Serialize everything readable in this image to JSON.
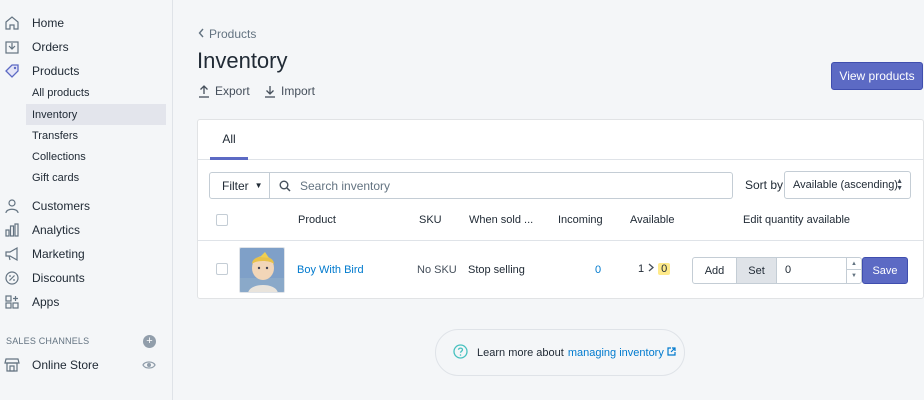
{
  "sidebar": {
    "nav": [
      {
        "label": "Home",
        "icon": "home-icon"
      },
      {
        "label": "Orders",
        "icon": "orders-icon"
      },
      {
        "label": "Products",
        "icon": "tag-icon"
      }
    ],
    "product_sub": [
      {
        "label": "All products"
      },
      {
        "label": "Inventory",
        "active": true
      },
      {
        "label": "Transfers"
      },
      {
        "label": "Collections"
      },
      {
        "label": "Gift cards"
      }
    ],
    "nav2": [
      {
        "label": "Customers",
        "icon": "person-icon"
      },
      {
        "label": "Analytics",
        "icon": "bar-chart-icon"
      },
      {
        "label": "Marketing",
        "icon": "megaphone-icon"
      },
      {
        "label": "Discounts",
        "icon": "discount-icon"
      },
      {
        "label": "Apps",
        "icon": "apps-icon"
      }
    ],
    "sales_channels_title": "SALES CHANNELS",
    "online_store": "Online Store"
  },
  "header": {
    "breadcrumb": "Products",
    "title": "Inventory",
    "export_label": "Export",
    "import_label": "Import",
    "view_products_label": "View products"
  },
  "card": {
    "tab_all": "All",
    "filter_label": "Filter",
    "search_placeholder": "Search inventory",
    "sort_label": "Sort by",
    "sort_value": "Available (ascending)",
    "columns": {
      "product": "Product",
      "sku": "SKU",
      "when_sold": "When sold ...",
      "incoming": "Incoming",
      "available": "Available",
      "edit_qty": "Edit quantity available"
    },
    "row": {
      "product": "Boy With Bird",
      "sku": "No SKU",
      "when_sold": "Stop selling",
      "incoming": "0",
      "available_from": "1",
      "available_to": "0",
      "add_label": "Add",
      "set_label": "Set",
      "quantity_value": "0",
      "save_label": "Save"
    }
  },
  "learn_more": {
    "prefix": "Learn more about",
    "link": "managing inventory"
  },
  "colors": {
    "accent": "#5c6ac4",
    "link": "#007ace",
    "highlight": "#ffea8a"
  }
}
